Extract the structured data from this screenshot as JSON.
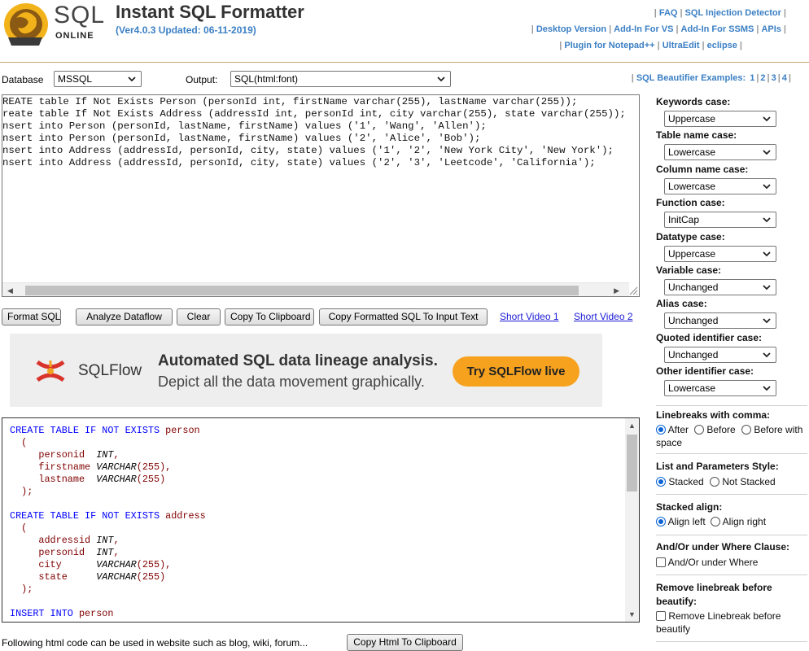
{
  "header": {
    "logo_text": "SQL",
    "logo_sub": "ONLINE",
    "title": "Instant SQL Formatter",
    "version": "(Ver4.0.3 Updated: 06-11-2019)",
    "links_row1": [
      "FAQ",
      "SQL Injection Detector"
    ],
    "links_row2": [
      "Desktop Version",
      "Add-In For VS",
      "Add-In For SSMS",
      "APIs"
    ],
    "links_row3": [
      "Plugin for Notepad++",
      "UltraEdit",
      "eclipse"
    ]
  },
  "options": {
    "database_label": "Database",
    "database_value": "MSSQL",
    "output_label": "Output:",
    "output_value": "SQL(html:font)",
    "examples_label": "SQL Beautifier Examples:",
    "examples": [
      "1",
      "2",
      "3",
      "4"
    ]
  },
  "input_sql": "REATE table If Not Exists Person (personId int, firstName varchar(255), lastName varchar(255));\nreate table If Not Exists Address (addressId int, personId int, city varchar(255), state varchar(255));\nnsert into Person (personId, lastName, firstName) values ('1', 'Wang', 'Allen');\nnsert into Person (personId, lastName, firstName) values ('2', 'Alice', 'Bob');\nnsert into Address (addressId, personId, city, state) values ('1', '2', 'New York City', 'New York');\nnsert into Address (addressId, personId, city, state) values ('2', '3', 'Leetcode', 'California');",
  "buttons": {
    "format": "Format SQL",
    "analyze": "Analyze Dataflow",
    "clear": "Clear",
    "copy_clipboard": "Copy To Clipboard",
    "copy_formatted": "Copy Formatted SQL To Input Text",
    "video1": "Short Video 1",
    "video2": "Short Video 2"
  },
  "banner": {
    "brand": "SQLFlow",
    "headline": "Automated SQL data lineage analysis.",
    "subline": "Depict all the data movement graphically.",
    "cta": "Try SQLFlow live"
  },
  "output_lines": [
    [
      [
        "kw",
        "CREATE TABLE IF NOT EXISTS"
      ],
      [
        "id",
        " person"
      ]
    ],
    [
      [
        "pu",
        "  ("
      ]
    ],
    [
      [
        "id",
        "     personid  "
      ],
      [
        "dt",
        "INT"
      ],
      [
        "pu",
        ","
      ]
    ],
    [
      [
        "id",
        "     firstname "
      ],
      [
        "dt",
        "VARCHAR"
      ],
      [
        "pu",
        "(255),"
      ]
    ],
    [
      [
        "id",
        "     lastname  "
      ],
      [
        "dt",
        "VARCHAR"
      ],
      [
        "pu",
        "(255)"
      ]
    ],
    [
      [
        "pu",
        "  );"
      ]
    ],
    [
      [
        "pu",
        ""
      ]
    ],
    [
      [
        "kw",
        "CREATE TABLE IF NOT EXISTS"
      ],
      [
        "id",
        " address"
      ]
    ],
    [
      [
        "pu",
        "  ("
      ]
    ],
    [
      [
        "id",
        "     addressid "
      ],
      [
        "dt",
        "INT"
      ],
      [
        "pu",
        ","
      ]
    ],
    [
      [
        "id",
        "     personid  "
      ],
      [
        "dt",
        "INT"
      ],
      [
        "pu",
        ","
      ]
    ],
    [
      [
        "id",
        "     city      "
      ],
      [
        "dt",
        "VARCHAR"
      ],
      [
        "pu",
        "(255),"
      ]
    ],
    [
      [
        "id",
        "     state     "
      ],
      [
        "dt",
        "VARCHAR"
      ],
      [
        "pu",
        "(255)"
      ]
    ],
    [
      [
        "pu",
        "  );"
      ]
    ],
    [
      [
        "pu",
        ""
      ]
    ],
    [
      [
        "kw",
        "INSERT INTO"
      ],
      [
        "id",
        " person"
      ]
    ]
  ],
  "footer": {
    "note": "Following html code can be used in website such as blog, wiki, forum...",
    "copy_html": "Copy Html To Clipboard"
  },
  "panel": {
    "cases": [
      {
        "label": "Keywords case:",
        "value": "Uppercase"
      },
      {
        "label": "Table name case:",
        "value": "Lowercase"
      },
      {
        "label": "Column name case:",
        "value": "Lowercase"
      },
      {
        "label": "Function case:",
        "value": "InitCap"
      },
      {
        "label": "Datatype case:",
        "value": "Uppercase"
      },
      {
        "label": "Variable case:",
        "value": "Unchanged"
      },
      {
        "label": "Alias case:",
        "value": "Unchanged"
      },
      {
        "label": "Quoted identifier case:",
        "value": "Unchanged"
      },
      {
        "label": "Other identifier case:",
        "value": "Lowercase"
      }
    ],
    "linebreaks_label": "Linebreaks with comma:",
    "linebreaks_after": "After",
    "linebreaks_before": "Before",
    "linebreaks_before_space_1": "Before with",
    "linebreaks_before_space_2": "space",
    "list_style_label": "List and Parameters Style:",
    "list_stacked": "Stacked",
    "list_not_stacked": "Not Stacked",
    "align_label": "Stacked align:",
    "align_left": "Align left",
    "align_right": "Align right",
    "andor_label": "And/Or under Where Clause:",
    "andor_check": "And/Or under Where",
    "remove_label_1": "Remove linebreak before",
    "remove_label_2": "beautify:",
    "remove_check_1": "Remove Linebreak before",
    "remove_check_2": "beautify"
  }
}
